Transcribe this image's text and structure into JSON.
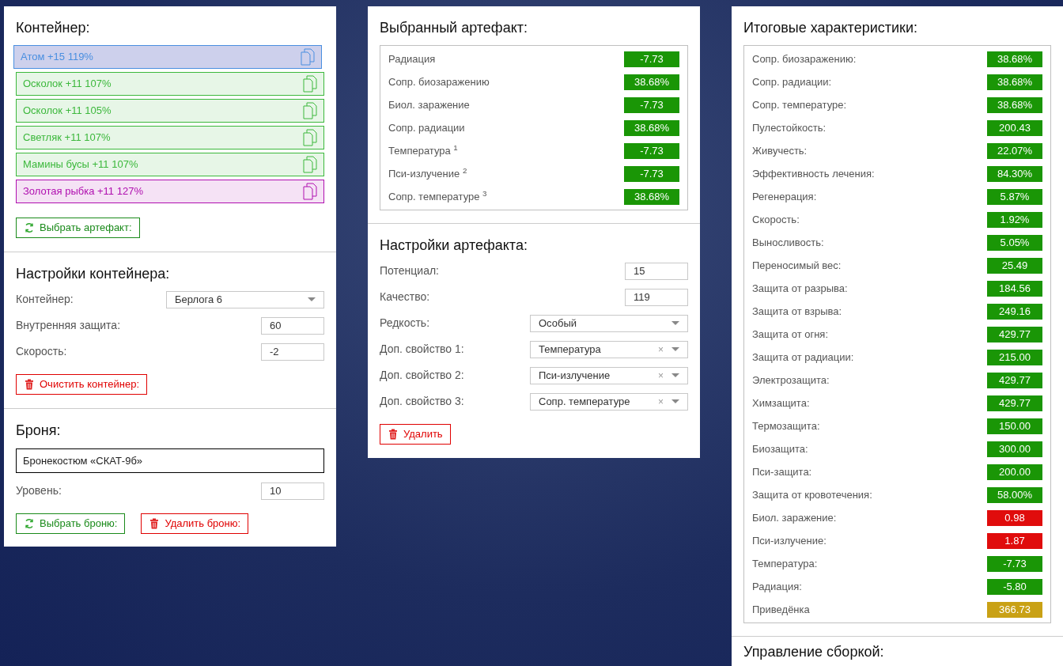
{
  "container": {
    "title": "Контейнер:",
    "artifacts": [
      {
        "label": "Атом +15 119%",
        "color": "#4a8fe0",
        "selected": true
      },
      {
        "label": "Осколок +11 107%",
        "color": "#3cb83c",
        "selected": false
      },
      {
        "label": "Осколок +11 105%",
        "color": "#3cb83c",
        "selected": false
      },
      {
        "label": "Светляк +11 107%",
        "color": "#3cb83c",
        "selected": false
      },
      {
        "label": "Мамины бусы +11 107%",
        "color": "#3cb83c",
        "selected": false
      },
      {
        "label": "Золотая рыбка +11 127%",
        "color": "#b010b0",
        "selected": false
      }
    ],
    "button": {
      "label": "Выбрать артефакт:",
      "kind": "select"
    }
  },
  "container_settings": {
    "title": "Настройки контейнера:",
    "fields": [
      {
        "label": "Контейнер:",
        "kind": "select",
        "value": "Берлога 6"
      },
      {
        "label": "Внутренняя защита:",
        "kind": "input",
        "value": "60"
      },
      {
        "label": "Скорость:",
        "kind": "input",
        "value": "-2"
      }
    ],
    "button": {
      "label": "Очистить контейнер:",
      "kind": "delete"
    }
  },
  "armor": {
    "title": "Броня:",
    "name": "Бронекостюм «СКАТ-9б»",
    "fields": [
      {
        "label": "Уровень:",
        "kind": "input",
        "value": "10"
      }
    ],
    "buttons": [
      {
        "label": "Выбрать броню:",
        "kind": "select"
      },
      {
        "label": "Удалить броню:",
        "kind": "delete"
      }
    ]
  },
  "selected_artifact": {
    "title": "Выбранный артефакт:",
    "stats": [
      {
        "label": "Радиация",
        "value": "-7.73",
        "color": "#1a9606"
      },
      {
        "label": "Сопр. биозаражению",
        "value": "38.68%",
        "color": "#1a9606"
      },
      {
        "label": "Биол. заражение",
        "value": "-7.73",
        "color": "#1a9606"
      },
      {
        "label": "Сопр. радиации",
        "value": "38.68%",
        "color": "#1a9606"
      },
      {
        "label": "Температура $^{1}$",
        "value": "-7.73",
        "color": "#1a9606"
      },
      {
        "label": "Пси-излучение $^{2}$",
        "value": "-7.73",
        "color": "#1a9606"
      },
      {
        "label": "Сопр. температуре $^{3}$",
        "value": "38.68%",
        "color": "#1a9606"
      }
    ]
  },
  "artifact_settings": {
    "title": "Настройки артефакта:",
    "fields": [
      {
        "label": "Потенциал:",
        "kind": "input",
        "value": "15"
      },
      {
        "label": "Качество:",
        "kind": "input",
        "value": "119"
      },
      {
        "label": "Редкость:",
        "kind": "select",
        "value": "Особый"
      },
      {
        "label": "Доп. свойство 1:",
        "kind": "select",
        "value": "Температура",
        "clear_icon": "×"
      },
      {
        "label": "Доп. свойство 2:",
        "kind": "select",
        "value": "Пси-излучение",
        "clear_icon": "×"
      },
      {
        "label": "Доп. свойство 3:",
        "kind": "select",
        "value": "Сопр. температуре",
        "clear_icon": "×"
      }
    ],
    "button": {
      "label": "Удалить",
      "kind": "delete"
    }
  },
  "totals": {
    "title": "Итоговые характеристики:",
    "stats": [
      {
        "label": "Сопр. биозаражению:",
        "value": "38.68%",
        "color": "#1a9606"
      },
      {
        "label": "Сопр. радиации:",
        "value": "38.68%",
        "color": "#1a9606"
      },
      {
        "label": "Сопр. температуре:",
        "value": "38.68%",
        "color": "#1a9606"
      },
      {
        "label": "Пулестойкость:",
        "value": "200.43",
        "color": "#1a9606"
      },
      {
        "label": "Живучесть:",
        "value": "22.07%",
        "color": "#1a9606"
      },
      {
        "label": "Эффективность лечения:",
        "value": "84.30%",
        "color": "#1a9606"
      },
      {
        "label": "Регенерация:",
        "value": "5.87%",
        "color": "#1a9606"
      },
      {
        "label": "Скорость:",
        "value": "1.92%",
        "color": "#1a9606"
      },
      {
        "label": "Выносливость:",
        "value": "5.05%",
        "color": "#1a9606"
      },
      {
        "label": "Переносимый вес:",
        "value": "25.49",
        "color": "#1a9606"
      },
      {
        "label": "Защита от разрыва:",
        "value": "184.56",
        "color": "#1a9606"
      },
      {
        "label": "Защита от взрыва:",
        "value": "249.16",
        "color": "#1a9606"
      },
      {
        "label": "Защита от огня:",
        "value": "429.77",
        "color": "#1a9606"
      },
      {
        "label": "Защита от радиации:",
        "value": "215.00",
        "color": "#1a9606"
      },
      {
        "label": "Электрозащита:",
        "value": "429.77",
        "color": "#1a9606"
      },
      {
        "label": "Химзащита:",
        "value": "429.77",
        "color": "#1a9606"
      },
      {
        "label": "Термозащита:",
        "value": "150.00",
        "color": "#1a9606"
      },
      {
        "label": "Биозащита:",
        "value": "300.00",
        "color": "#1a9606"
      },
      {
        "label": "Пси-защита:",
        "value": "200.00",
        "color": "#1a9606"
      },
      {
        "label": "Защита от кровотечения:",
        "value": "58.00%",
        "color": "#1a9606"
      },
      {
        "label": "Биол. заражение:",
        "value": "0.98",
        "color": "#e00c0c"
      },
      {
        "label": "Пси-излучение:",
        "value": "1.87",
        "color": "#e00c0c"
      },
      {
        "label": "Температура:",
        "value": "-7.73",
        "color": "#1a9606"
      },
      {
        "label": "Радиация:",
        "value": "-5.80",
        "color": "#1a9606"
      },
      {
        "label": "Приведёнка",
        "value": "366.73",
        "color": "#c9a115"
      }
    ]
  },
  "build_management": {
    "title": "Управление сборкой:"
  }
}
